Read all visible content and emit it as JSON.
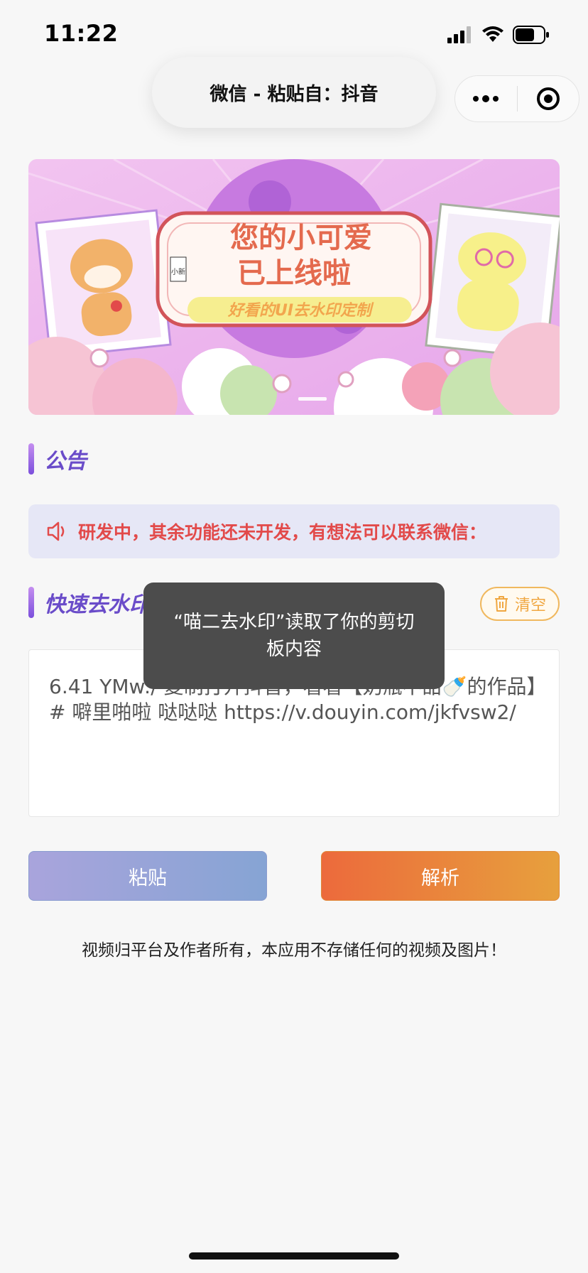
{
  "status_bar": {
    "time": "11:22"
  },
  "header": {
    "title": "微信 - 粘贴自：抖音"
  },
  "banner": {
    "headline_line1": "您的小可爱",
    "headline_line2": "已上线啦",
    "subline": "好看的UI去水印定制",
    "badge": "小新"
  },
  "notice_section": {
    "title": "公告"
  },
  "notice": {
    "text": "研发中，其余功能还未开发，有想法可以联系微信："
  },
  "quick_section": {
    "title": "快速去水印",
    "clear_label": "清空"
  },
  "input": {
    "value": "6.41 YMw:/ 复制打开抖音，看看【奶瓶不甜🍼的作品】# 噼里啪啦 哒哒哒 https://v.douyin.com/jkfvsw2/"
  },
  "buttons": {
    "paste_label": "粘贴",
    "parse_label": "解析"
  },
  "disclaimer": "视频归平台及作者所有，本应用不存储任何的视频及图片！",
  "toast": {
    "text": "“喵二去水印”读取了你的剪切板内容"
  },
  "colors": {
    "accent_purple": "#6a4cc9",
    "notice_red": "#e24a4a",
    "clear_orange": "#f0a741",
    "parse_orange": "#ec6a3c",
    "paste_blue": "#86a4d4"
  }
}
